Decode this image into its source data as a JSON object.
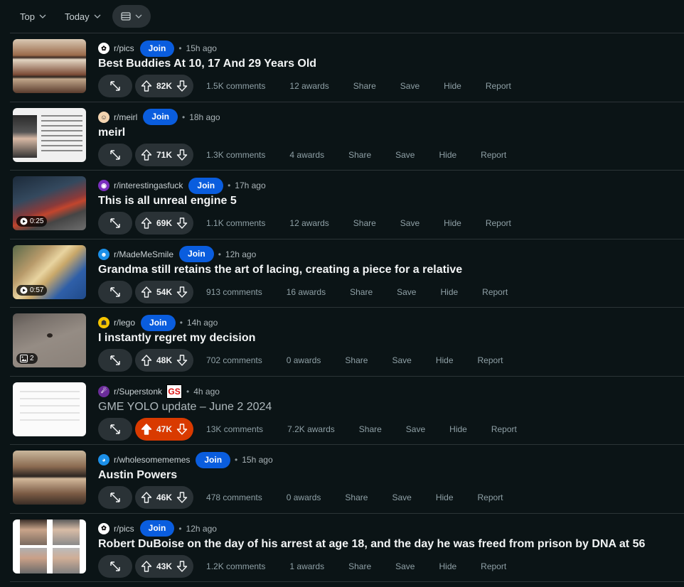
{
  "toolbar": {
    "sort_label": "Top",
    "time_label": "Today",
    "view_icon": "card-view-icon"
  },
  "colors": {
    "join": "#0a5dde",
    "upvoted": "#d93a00",
    "background": "#0b1416"
  },
  "posts": [
    {
      "subreddit": "r/pics",
      "join": "Join",
      "time": "15h ago",
      "title": "Best Buddies At 10, 17 And 29 Years Old",
      "votes": "82K",
      "comments": "1.5K comments",
      "awards": "12 awards",
      "share": "Share",
      "save": "Save",
      "hide": "Hide",
      "report": "Report",
      "badge": ""
    },
    {
      "subreddit": "r/meirl",
      "join": "Join",
      "time": "18h ago",
      "title": "meirl",
      "votes": "71K",
      "comments": "1.3K comments",
      "awards": "4 awards",
      "share": "Share",
      "save": "Save",
      "hide": "Hide",
      "report": "Report",
      "badge": ""
    },
    {
      "subreddit": "r/interestingasfuck",
      "join": "Join",
      "time": "17h ago",
      "title": "This is all unreal engine 5",
      "votes": "69K",
      "comments": "1.1K comments",
      "awards": "12 awards",
      "share": "Share",
      "save": "Save",
      "hide": "Hide",
      "report": "Report",
      "badge": "0:25"
    },
    {
      "subreddit": "r/MadeMeSmile",
      "join": "Join",
      "time": "12h ago",
      "title": "Grandma still retains the art of lacing, creating a piece for a relative",
      "votes": "54K",
      "comments": "913 comments",
      "awards": "16 awards",
      "share": "Share",
      "save": "Save",
      "hide": "Hide",
      "report": "Report",
      "badge": "0:57"
    },
    {
      "subreddit": "r/lego",
      "join": "Join",
      "time": "14h ago",
      "title": "I instantly regret my decision",
      "votes": "48K",
      "comments": "702 comments",
      "awards": "0 awards",
      "share": "Share",
      "save": "Save",
      "hide": "Hide",
      "report": "Report",
      "badge": "2"
    },
    {
      "subreddit": "r/Superstonk",
      "join": "",
      "flair": "GS",
      "time": "4h ago",
      "title": "GME YOLO update – June 2 2024",
      "votes": "47K",
      "comments": "13K comments",
      "awards": "7.2K awards",
      "share": "Share",
      "save": "Save",
      "hide": "Hide",
      "report": "Report",
      "badge": ""
    },
    {
      "subreddit": "r/wholesomememes",
      "join": "Join",
      "time": "15h ago",
      "title": "Austin Powers",
      "votes": "46K",
      "comments": "478 comments",
      "awards": "0 awards",
      "share": "Share",
      "save": "Save",
      "hide": "Hide",
      "report": "Report",
      "badge": ""
    },
    {
      "subreddit": "r/pics",
      "join": "Join",
      "time": "12h ago",
      "title": "Robert DuBoise on the day of his arrest at age 18, and the day he was freed from prison by DNA at 56",
      "votes": "43K",
      "comments": "1.2K comments",
      "awards": "1 awards",
      "share": "Share",
      "save": "Save",
      "hide": "Hide",
      "report": "Report",
      "badge": ""
    }
  ]
}
